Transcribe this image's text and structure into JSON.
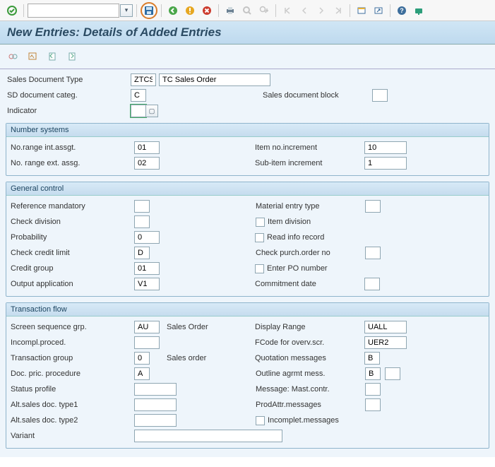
{
  "toolbar": {
    "dropdown_value": ""
  },
  "page_title": "New Entries: Details of Added Entries",
  "header": {
    "sales_doc_type_label": "Sales Document Type",
    "sales_doc_type_code": "ZTCS",
    "sales_doc_type_desc": "TC Sales Order",
    "sd_doc_categ_label": "SD document categ.",
    "sd_doc_categ_value": "C",
    "sales_doc_block_label": "Sales document block",
    "sales_doc_block_value": "",
    "indicator_label": "Indicator",
    "indicator_value": ""
  },
  "groups": {
    "number_systems": {
      "title": "Number systems",
      "no_range_int_label": "No.range int.assgt.",
      "no_range_int_value": "01",
      "item_inc_label": "Item no.increment",
      "item_inc_value": "10",
      "no_range_ext_label": "No. range ext. assg.",
      "no_range_ext_value": "02",
      "subitem_inc_label": "Sub-item increment",
      "subitem_inc_value": "1"
    },
    "general_control": {
      "title": "General control",
      "ref_mand_label": "Reference mandatory",
      "ref_mand_value": "",
      "mat_entry_label": "Material entry type",
      "mat_entry_value": "",
      "check_div_label": "Check division",
      "check_div_value": "",
      "item_div_label": "Item division",
      "prob_label": "Probability",
      "prob_value": "0",
      "read_info_label": "Read info record",
      "check_credit_label": "Check credit limit",
      "check_credit_value": "D",
      "check_po_label": "Check purch.order no",
      "check_po_value": "",
      "credit_group_label": "Credit group",
      "credit_group_value": "01",
      "enter_po_label": "Enter PO number",
      "output_app_label": "Output application",
      "output_app_value": "V1",
      "commit_date_label": "Commitment  date",
      "commit_date_value": ""
    },
    "transaction_flow": {
      "title": "Transaction flow",
      "screen_seq_label": "Screen sequence grp.",
      "screen_seq_value": "AU",
      "screen_seq_desc": "Sales Order",
      "display_range_label": "Display Range",
      "display_range_value": "UALL",
      "incompl_proc_label": "Incompl.proced.",
      "incompl_proc_value": "",
      "fcode_label": "FCode for overv.scr.",
      "fcode_value": "UER2",
      "trans_group_label": "Transaction group",
      "trans_group_value": "0",
      "trans_group_desc": "Sales order",
      "quot_msg_label": "Quotation messages",
      "quot_msg_value": "B",
      "doc_pric_label": "Doc. pric. procedure",
      "doc_pric_value": "A",
      "outline_msg_label": "Outline agrmt mess.",
      "outline_msg_value": "B",
      "outline_msg_extra": "",
      "status_prof_label": "Status profile",
      "status_prof_value": "",
      "msg_mast_label": "Message: Mast.contr.",
      "msg_mast_value": "",
      "alt_type1_label": "Alt.sales doc. type1",
      "alt_type1_value": "",
      "prodattr_label": "ProdAttr.messages",
      "prodattr_value": "",
      "alt_type2_label": "Alt.sales doc. type2",
      "alt_type2_value": "",
      "incomplet_msg_label": "Incomplet.messages",
      "variant_label": "Variant",
      "variant_value": ""
    }
  }
}
